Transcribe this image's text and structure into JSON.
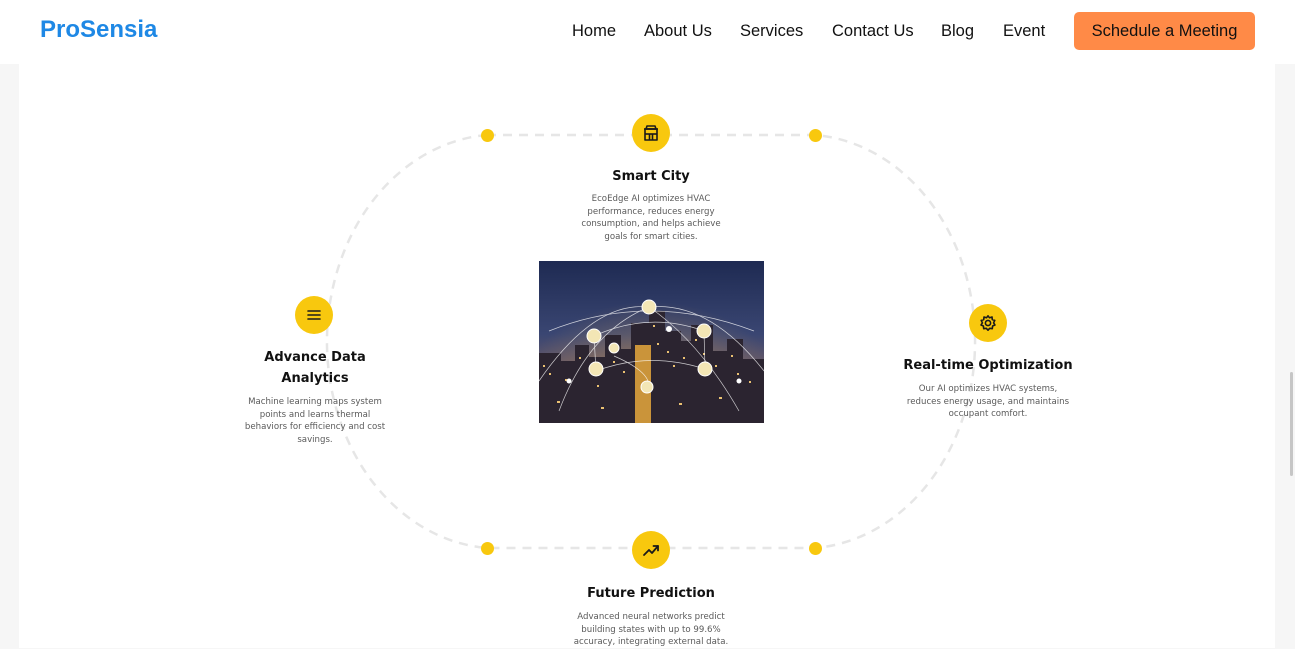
{
  "header": {
    "logo": "ProSensia",
    "nav": [
      {
        "label": "Home"
      },
      {
        "label": "About Us"
      },
      {
        "label": "Services"
      },
      {
        "label": "Contact Us"
      },
      {
        "label": "Blog"
      },
      {
        "label": "Event"
      }
    ],
    "cta_label": "Schedule a Meeting"
  },
  "features": {
    "smart_city": {
      "icon": "building-icon",
      "title": "Smart City",
      "description": "EcoEdge AI optimizes HVAC performance, reduces energy consumption, and helps achieve goals for smart cities."
    },
    "analytics": {
      "icon": "data-lines-icon",
      "title": "Advance Data Analytics",
      "description": "Machine learning maps system points and learns thermal behaviors for efficiency and cost savings."
    },
    "optimization": {
      "icon": "gear-icon",
      "title": "Real-time Optimization",
      "description": "Our AI optimizes HVAC systems, reduces energy usage, and maintains occupant comfort."
    },
    "prediction": {
      "icon": "trending-up-icon",
      "title": "Future Prediction",
      "description": "Advanced neural networks predict building states with up to 99.6% accuracy, integrating external data."
    }
  },
  "colors": {
    "accent": "#f8c80e",
    "logo": "#1e88e5",
    "cta": "#ff8a47",
    "ring": "#e5e5e5"
  }
}
